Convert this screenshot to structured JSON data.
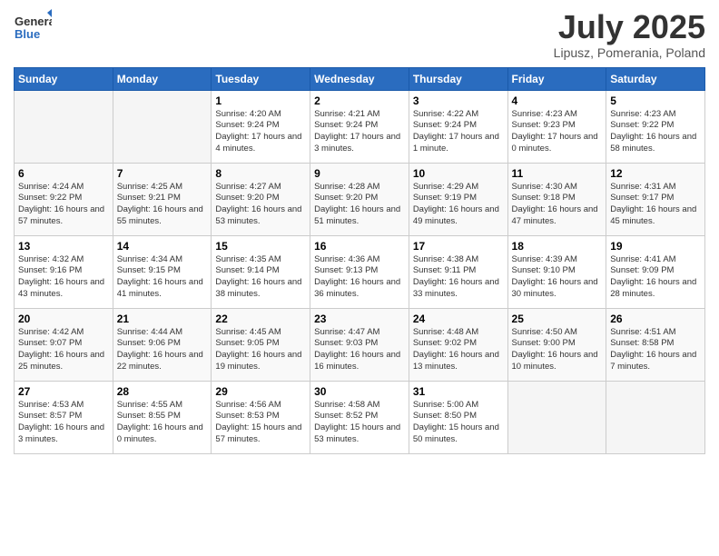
{
  "header": {
    "logo_general": "General",
    "logo_blue": "Blue",
    "month": "July 2025",
    "location": "Lipusz, Pomerania, Poland"
  },
  "days_of_week": [
    "Sunday",
    "Monday",
    "Tuesday",
    "Wednesday",
    "Thursday",
    "Friday",
    "Saturday"
  ],
  "weeks": [
    [
      {
        "day": "",
        "info": ""
      },
      {
        "day": "",
        "info": ""
      },
      {
        "day": "1",
        "info": "Sunrise: 4:20 AM\nSunset: 9:24 PM\nDaylight: 17 hours and 4 minutes."
      },
      {
        "day": "2",
        "info": "Sunrise: 4:21 AM\nSunset: 9:24 PM\nDaylight: 17 hours and 3 minutes."
      },
      {
        "day": "3",
        "info": "Sunrise: 4:22 AM\nSunset: 9:24 PM\nDaylight: 17 hours and 1 minute."
      },
      {
        "day": "4",
        "info": "Sunrise: 4:23 AM\nSunset: 9:23 PM\nDaylight: 17 hours and 0 minutes."
      },
      {
        "day": "5",
        "info": "Sunrise: 4:23 AM\nSunset: 9:22 PM\nDaylight: 16 hours and 58 minutes."
      }
    ],
    [
      {
        "day": "6",
        "info": "Sunrise: 4:24 AM\nSunset: 9:22 PM\nDaylight: 16 hours and 57 minutes."
      },
      {
        "day": "7",
        "info": "Sunrise: 4:25 AM\nSunset: 9:21 PM\nDaylight: 16 hours and 55 minutes."
      },
      {
        "day": "8",
        "info": "Sunrise: 4:27 AM\nSunset: 9:20 PM\nDaylight: 16 hours and 53 minutes."
      },
      {
        "day": "9",
        "info": "Sunrise: 4:28 AM\nSunset: 9:20 PM\nDaylight: 16 hours and 51 minutes."
      },
      {
        "day": "10",
        "info": "Sunrise: 4:29 AM\nSunset: 9:19 PM\nDaylight: 16 hours and 49 minutes."
      },
      {
        "day": "11",
        "info": "Sunrise: 4:30 AM\nSunset: 9:18 PM\nDaylight: 16 hours and 47 minutes."
      },
      {
        "day": "12",
        "info": "Sunrise: 4:31 AM\nSunset: 9:17 PM\nDaylight: 16 hours and 45 minutes."
      }
    ],
    [
      {
        "day": "13",
        "info": "Sunrise: 4:32 AM\nSunset: 9:16 PM\nDaylight: 16 hours and 43 minutes."
      },
      {
        "day": "14",
        "info": "Sunrise: 4:34 AM\nSunset: 9:15 PM\nDaylight: 16 hours and 41 minutes."
      },
      {
        "day": "15",
        "info": "Sunrise: 4:35 AM\nSunset: 9:14 PM\nDaylight: 16 hours and 38 minutes."
      },
      {
        "day": "16",
        "info": "Sunrise: 4:36 AM\nSunset: 9:13 PM\nDaylight: 16 hours and 36 minutes."
      },
      {
        "day": "17",
        "info": "Sunrise: 4:38 AM\nSunset: 9:11 PM\nDaylight: 16 hours and 33 minutes."
      },
      {
        "day": "18",
        "info": "Sunrise: 4:39 AM\nSunset: 9:10 PM\nDaylight: 16 hours and 30 minutes."
      },
      {
        "day": "19",
        "info": "Sunrise: 4:41 AM\nSunset: 9:09 PM\nDaylight: 16 hours and 28 minutes."
      }
    ],
    [
      {
        "day": "20",
        "info": "Sunrise: 4:42 AM\nSunset: 9:07 PM\nDaylight: 16 hours and 25 minutes."
      },
      {
        "day": "21",
        "info": "Sunrise: 4:44 AM\nSunset: 9:06 PM\nDaylight: 16 hours and 22 minutes."
      },
      {
        "day": "22",
        "info": "Sunrise: 4:45 AM\nSunset: 9:05 PM\nDaylight: 16 hours and 19 minutes."
      },
      {
        "day": "23",
        "info": "Sunrise: 4:47 AM\nSunset: 9:03 PM\nDaylight: 16 hours and 16 minutes."
      },
      {
        "day": "24",
        "info": "Sunrise: 4:48 AM\nSunset: 9:02 PM\nDaylight: 16 hours and 13 minutes."
      },
      {
        "day": "25",
        "info": "Sunrise: 4:50 AM\nSunset: 9:00 PM\nDaylight: 16 hours and 10 minutes."
      },
      {
        "day": "26",
        "info": "Sunrise: 4:51 AM\nSunset: 8:58 PM\nDaylight: 16 hours and 7 minutes."
      }
    ],
    [
      {
        "day": "27",
        "info": "Sunrise: 4:53 AM\nSunset: 8:57 PM\nDaylight: 16 hours and 3 minutes."
      },
      {
        "day": "28",
        "info": "Sunrise: 4:55 AM\nSunset: 8:55 PM\nDaylight: 16 hours and 0 minutes."
      },
      {
        "day": "29",
        "info": "Sunrise: 4:56 AM\nSunset: 8:53 PM\nDaylight: 15 hours and 57 minutes."
      },
      {
        "day": "30",
        "info": "Sunrise: 4:58 AM\nSunset: 8:52 PM\nDaylight: 15 hours and 53 minutes."
      },
      {
        "day": "31",
        "info": "Sunrise: 5:00 AM\nSunset: 8:50 PM\nDaylight: 15 hours and 50 minutes."
      },
      {
        "day": "",
        "info": ""
      },
      {
        "day": "",
        "info": ""
      }
    ]
  ]
}
